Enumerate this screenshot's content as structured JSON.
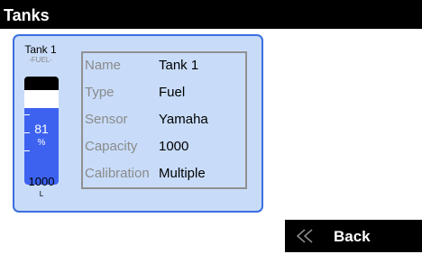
{
  "screen": {
    "title": "Tanks"
  },
  "tank": {
    "name": "Tank 1",
    "type_tag": "-FUEL-",
    "level_value": "81",
    "level_unit": "%",
    "level_percent": 81,
    "capacity_value": "1000",
    "capacity_unit": "L",
    "colors": {
      "fill": "#3d62f0",
      "card_bg": "#c8dcf9",
      "card_border": "#3a6fe0"
    }
  },
  "details": {
    "rows": [
      {
        "label": "Name",
        "value": "Tank 1"
      },
      {
        "label": "Type",
        "value": "Fuel"
      },
      {
        "label": "Sensor",
        "value": "Yamaha"
      },
      {
        "label": "Capacity",
        "value": "1000"
      },
      {
        "label": "Calibration",
        "value": "Multiple"
      }
    ]
  },
  "footer": {
    "back_label": "Back",
    "back_icon": "double-chevron-left-icon"
  }
}
